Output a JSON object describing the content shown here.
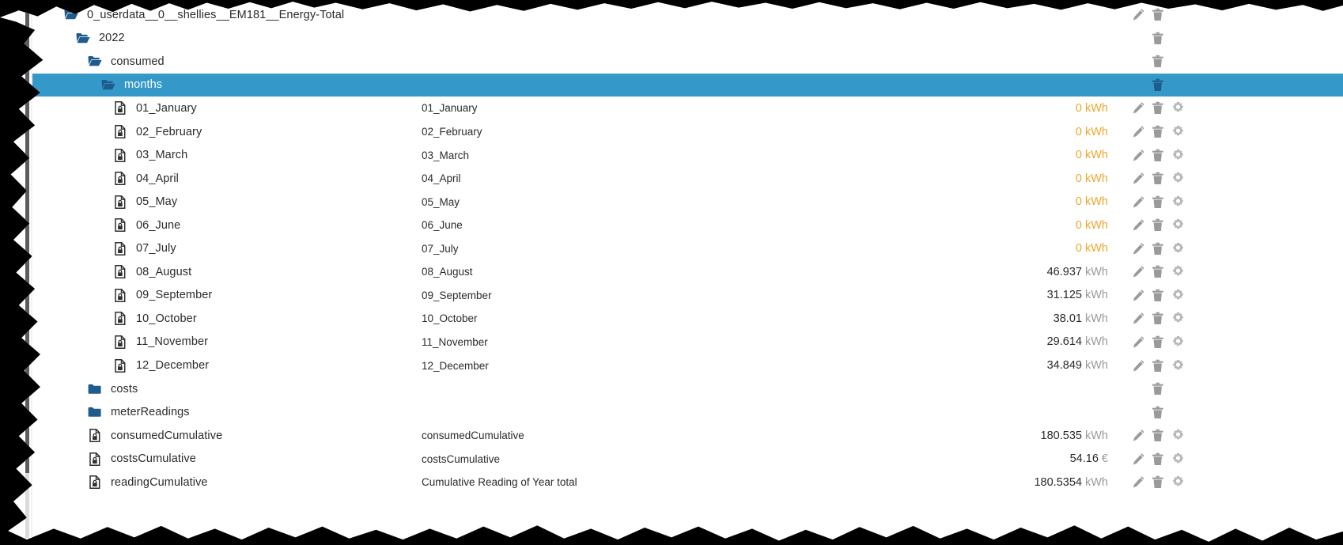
{
  "theme": {
    "selection_color": "#3498c8",
    "folder_color": "#1f5c8b",
    "zero_value_color": "#f0a62c",
    "unit_color": "#9a9a9a",
    "text_color": "#2b2b2b",
    "action_icon_color": "#9a9a9a",
    "action_icon_selected_color": "#1f5c8b"
  },
  "icons": {
    "folder_open": "folder-open-icon",
    "folder_closed": "folder-closed-icon",
    "file_locked": "file-locked-icon",
    "edit": "pencil-icon",
    "delete": "trash-icon",
    "settings": "gear-icon"
  },
  "tree": {
    "rows": [
      {
        "name": "0_userdata__0__shellies__EM181__Energy-Total",
        "icon": "folder_open",
        "depth": 0,
        "desc": "",
        "value": "",
        "unit": "",
        "selected": false,
        "actions": [
          "edit",
          "delete"
        ]
      },
      {
        "name": "2022",
        "icon": "folder_open",
        "depth": 1,
        "desc": "",
        "value": "",
        "unit": "",
        "selected": false,
        "actions": [
          "delete"
        ]
      },
      {
        "name": "consumed",
        "icon": "folder_open",
        "depth": 2,
        "desc": "",
        "value": "",
        "unit": "",
        "selected": false,
        "actions": [
          "delete"
        ]
      },
      {
        "name": "months",
        "icon": "folder_open",
        "depth": 3,
        "desc": "",
        "value": "",
        "unit": "",
        "selected": true,
        "actions": [
          "delete"
        ]
      },
      {
        "name": "01_January",
        "icon": "file_locked",
        "depth": 4,
        "desc": "01_January",
        "value": "0",
        "unit": "kWh",
        "selected": false,
        "actions": [
          "edit",
          "delete",
          "settings"
        ]
      },
      {
        "name": "02_February",
        "icon": "file_locked",
        "depth": 4,
        "desc": "02_February",
        "value": "0",
        "unit": "kWh",
        "selected": false,
        "actions": [
          "edit",
          "delete",
          "settings"
        ]
      },
      {
        "name": "03_March",
        "icon": "file_locked",
        "depth": 4,
        "desc": "03_March",
        "value": "0",
        "unit": "kWh",
        "selected": false,
        "actions": [
          "edit",
          "delete",
          "settings"
        ]
      },
      {
        "name": "04_April",
        "icon": "file_locked",
        "depth": 4,
        "desc": "04_April",
        "value": "0",
        "unit": "kWh",
        "selected": false,
        "actions": [
          "edit",
          "delete",
          "settings"
        ]
      },
      {
        "name": "05_May",
        "icon": "file_locked",
        "depth": 4,
        "desc": "05_May",
        "value": "0",
        "unit": "kWh",
        "selected": false,
        "actions": [
          "edit",
          "delete",
          "settings"
        ]
      },
      {
        "name": "06_June",
        "icon": "file_locked",
        "depth": 4,
        "desc": "06_June",
        "value": "0",
        "unit": "kWh",
        "selected": false,
        "actions": [
          "edit",
          "delete",
          "settings"
        ]
      },
      {
        "name": "07_July",
        "icon": "file_locked",
        "depth": 4,
        "desc": "07_July",
        "value": "0",
        "unit": "kWh",
        "selected": false,
        "actions": [
          "edit",
          "delete",
          "settings"
        ]
      },
      {
        "name": "08_August",
        "icon": "file_locked",
        "depth": 4,
        "desc": "08_August",
        "value": "46.937",
        "unit": "kWh",
        "selected": false,
        "actions": [
          "edit",
          "delete",
          "settings"
        ]
      },
      {
        "name": "09_September",
        "icon": "file_locked",
        "depth": 4,
        "desc": "09_September",
        "value": "31.125",
        "unit": "kWh",
        "selected": false,
        "actions": [
          "edit",
          "delete",
          "settings"
        ]
      },
      {
        "name": "10_October",
        "icon": "file_locked",
        "depth": 4,
        "desc": "10_October",
        "value": "38.01",
        "unit": "kWh",
        "selected": false,
        "actions": [
          "edit",
          "delete",
          "settings"
        ]
      },
      {
        "name": "11_November",
        "icon": "file_locked",
        "depth": 4,
        "desc": "11_November",
        "value": "29.614",
        "unit": "kWh",
        "selected": false,
        "actions": [
          "edit",
          "delete",
          "settings"
        ]
      },
      {
        "name": "12_December",
        "icon": "file_locked",
        "depth": 4,
        "desc": "12_December",
        "value": "34.849",
        "unit": "kWh",
        "selected": false,
        "actions": [
          "edit",
          "delete",
          "settings"
        ]
      },
      {
        "name": "costs",
        "icon": "folder_closed",
        "depth": 2,
        "desc": "",
        "value": "",
        "unit": "",
        "selected": false,
        "actions": [
          "delete"
        ]
      },
      {
        "name": "meterReadings",
        "icon": "folder_closed",
        "depth": 2,
        "desc": "",
        "value": "",
        "unit": "",
        "selected": false,
        "actions": [
          "delete"
        ]
      },
      {
        "name": "consumedCumulative",
        "icon": "file_locked",
        "depth": 2,
        "desc": "consumedCumulative",
        "value": "180.535",
        "unit": "kWh",
        "selected": false,
        "actions": [
          "edit",
          "delete",
          "settings"
        ]
      },
      {
        "name": "costsCumulative",
        "icon": "file_locked",
        "depth": 2,
        "desc": "costsCumulative",
        "value": "54.16",
        "unit": "€",
        "selected": false,
        "actions": [
          "edit",
          "delete",
          "settings"
        ]
      },
      {
        "name": "readingCumulative",
        "icon": "file_locked",
        "depth": 2,
        "desc": "Cumulative Reading of Year total",
        "value": "180.5354",
        "unit": "kWh",
        "selected": false,
        "actions": [
          "edit",
          "delete",
          "settings"
        ]
      }
    ]
  },
  "scrollbar": {
    "orientation": "vertical",
    "position": "left"
  }
}
